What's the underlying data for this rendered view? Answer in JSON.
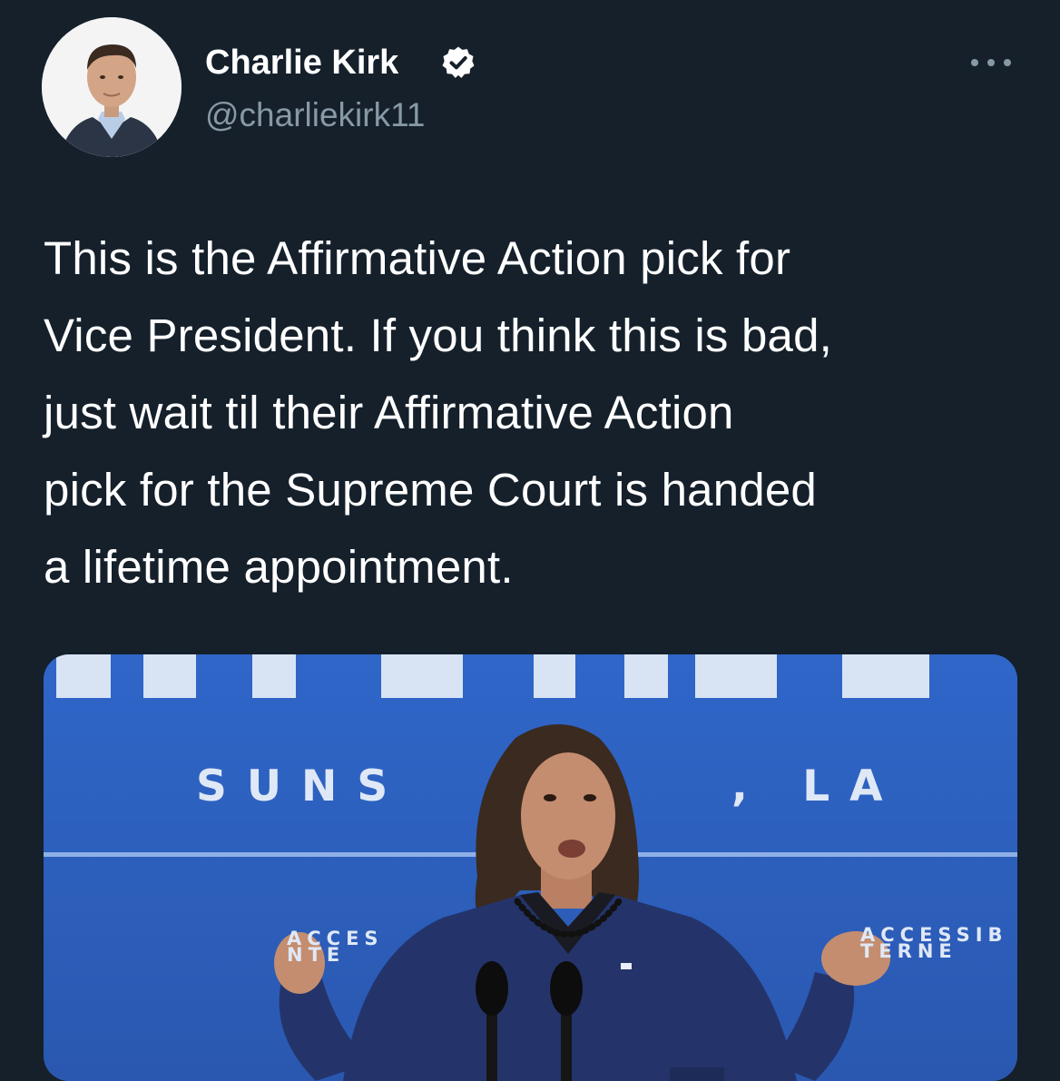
{
  "tweet": {
    "author_name": "Charlie Kirk",
    "author_handle": "@charliekirk11",
    "text_lines": [
      "This is the Affirmative Action pick for",
      "Vice President. If you think this is bad,",
      "just wait til their Affirmative Action",
      "pick for the Supreme Court is handed",
      "a lifetime appointment."
    ]
  },
  "media": {
    "sign_main_left": "SUNS",
    "sign_main_right": ", LA",
    "sign_small_left_line1": "ACCES",
    "sign_small_left_line2": "NTE",
    "sign_small_right_line1": "ACCESSIB",
    "sign_small_right_line2": "TERNE"
  },
  "icons": {
    "verified": "verified-badge-icon",
    "more": "more-options-icon"
  },
  "colors": {
    "background": "#15202b",
    "secondary_text": "#8899a6",
    "media_backdrop": "#2d63c4"
  }
}
